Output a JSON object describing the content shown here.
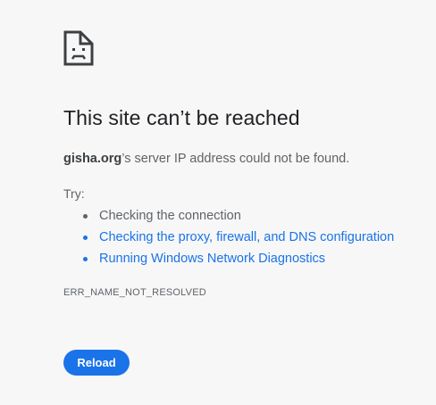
{
  "error": {
    "icon": "sad-page-icon",
    "title": "This site can’t be reached",
    "summary": {
      "host": "gisha.org",
      "text": "’s server IP address could not be found."
    },
    "try_label": "Try:",
    "suggestions": [
      {
        "label": "Checking the connection",
        "is_link": false
      },
      {
        "label": "Checking the proxy, firewall, and DNS configuration",
        "is_link": true
      },
      {
        "label": "Running Windows Network Diagnostics",
        "is_link": true
      }
    ],
    "error_code": "ERR_NAME_NOT_RESOLVED",
    "reload_label": "Reload"
  },
  "colors": {
    "background": "#f7f7f7",
    "link": "#1a73e8",
    "button": "#1a73e8",
    "text": "#202124",
    "secondary_text": "#5f6368"
  }
}
